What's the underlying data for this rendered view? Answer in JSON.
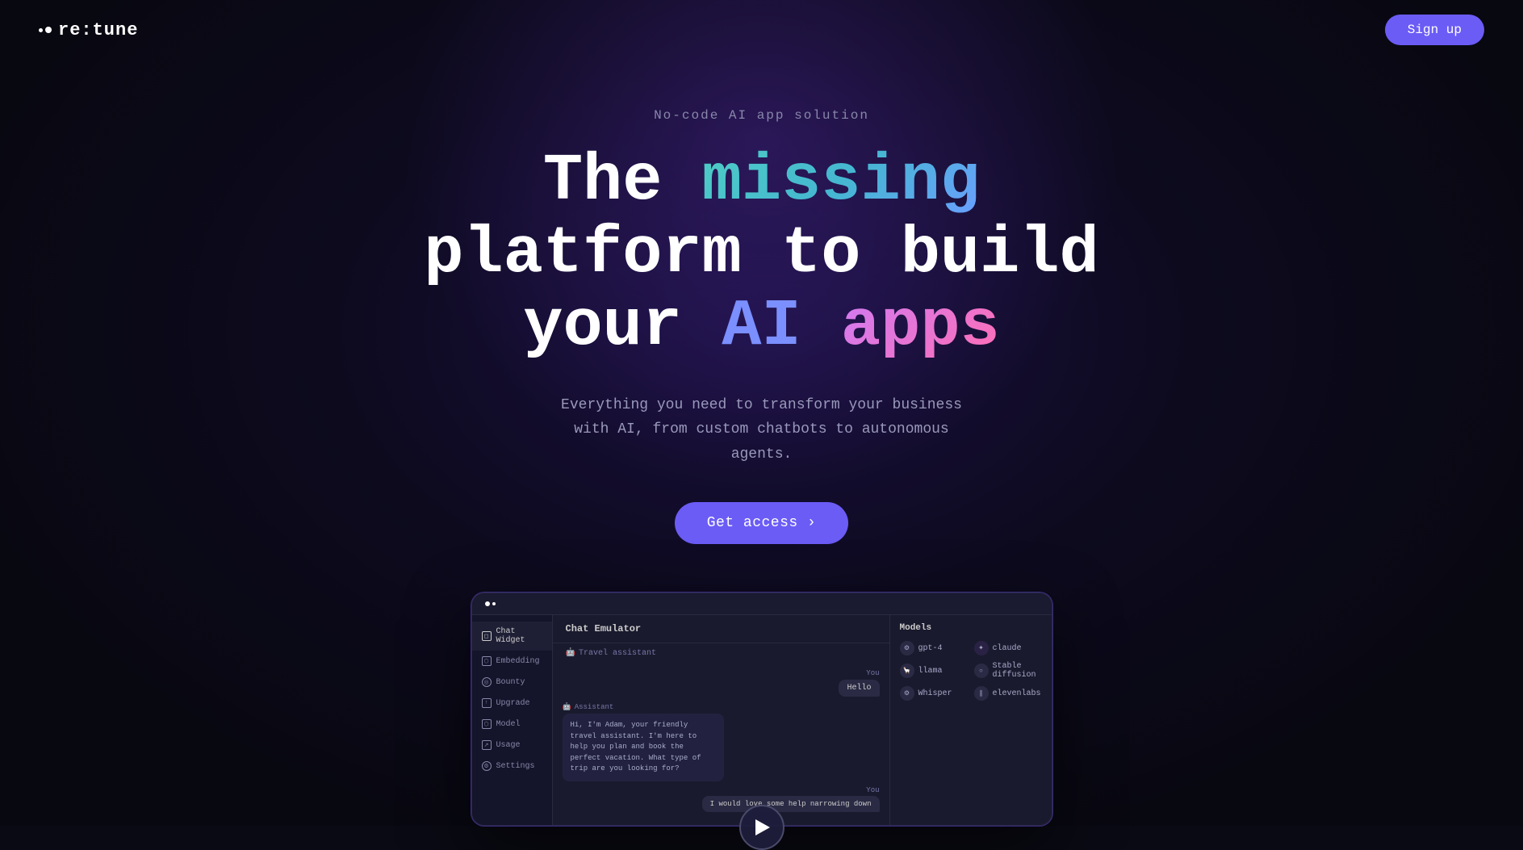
{
  "nav": {
    "logo_text": "re:tune",
    "signup_label": "Sign up"
  },
  "hero": {
    "subtitle": "No-code AI app solution",
    "title_line1_start": "The ",
    "title_line1_missing": "missing",
    "title_line2": "platform to build",
    "title_line3_start": "your ",
    "title_line3_ai": "AI",
    "title_line3_apps": " apps",
    "description": "Everything you need to transform your business with AI, from custom chatbots to autonomous agents.",
    "cta_label": "Get access ›"
  },
  "app_preview": {
    "header_label": "Chat Emulator",
    "models_label": "Models",
    "chat_assistant_name": "Travel assistant",
    "sidebar_items": [
      {
        "label": "Chat Widget",
        "active": true
      },
      {
        "label": "Embedding",
        "active": false
      },
      {
        "label": "Bounty",
        "active": false
      },
      {
        "label": "Upgrade",
        "active": false
      },
      {
        "label": "Model",
        "active": false
      },
      {
        "label": "Usage",
        "active": false
      },
      {
        "label": "Settings",
        "active": false
      }
    ],
    "messages": [
      {
        "role": "you",
        "text": "Hello"
      },
      {
        "role": "assistant",
        "text": "Hi, I'm Adam, your friendly travel assistant. I'm here to help you plan and book the perfect vacation. What type of trip are you looking for?"
      },
      {
        "role": "you",
        "text": "I would love some help narrowing down"
      }
    ],
    "models": [
      {
        "name": "gpt-4",
        "icon": "⚙"
      },
      {
        "name": "claude",
        "icon": "✦"
      },
      {
        "name": "llama",
        "icon": "🦙"
      },
      {
        "name": "Stable diffusion",
        "icon": "○"
      },
      {
        "name": "Whisper",
        "icon": "⚙"
      },
      {
        "name": "elevenlabs",
        "icon": "||"
      }
    ]
  }
}
